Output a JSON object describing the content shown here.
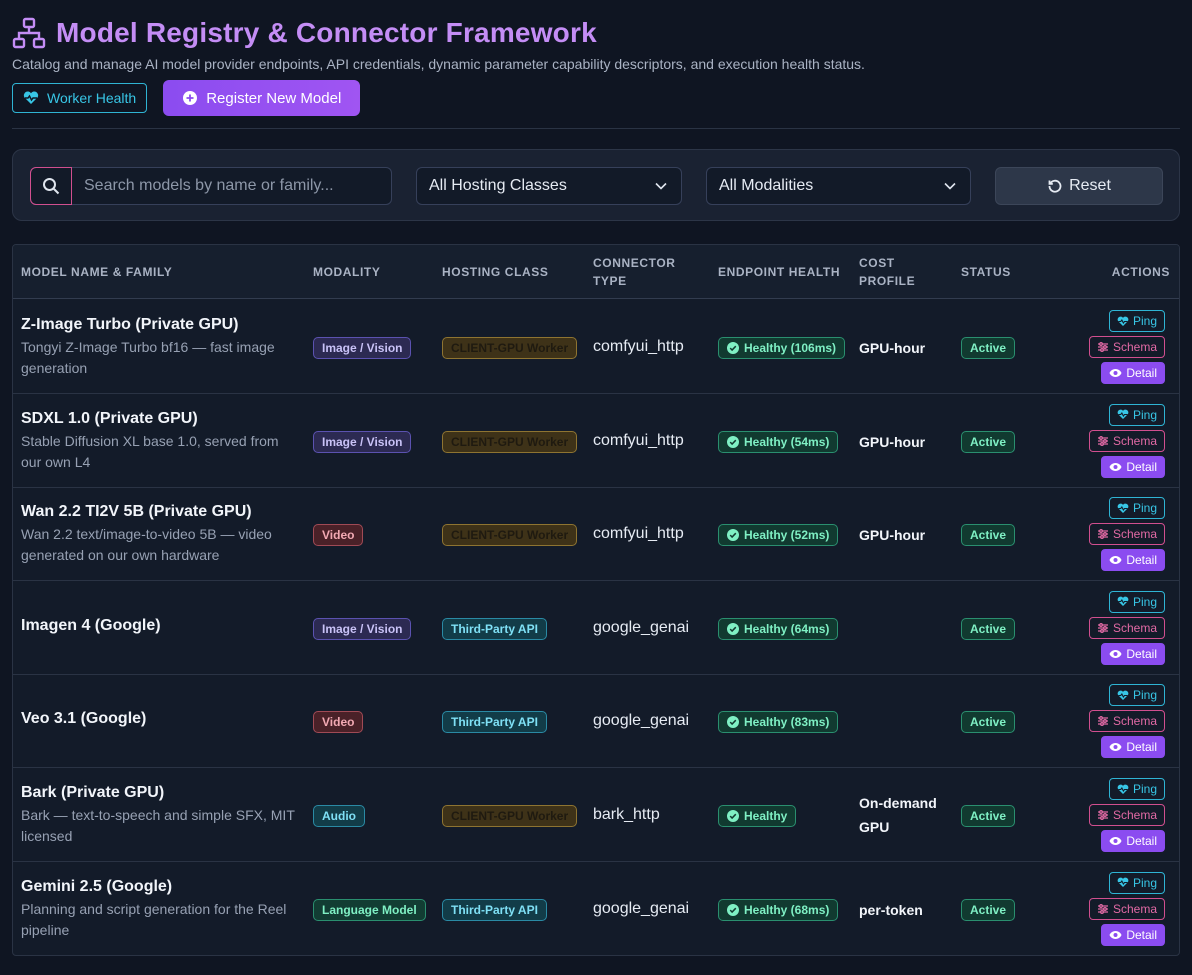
{
  "header": {
    "title": "Model Registry & Connector Framework",
    "subtitle": "Catalog and manage AI model provider endpoints, API credentials, dynamic parameter capability descriptors, and execution health status.",
    "worker_health_label": "Worker Health",
    "register_label": "Register New Model"
  },
  "filters": {
    "search_placeholder": "Search models by name or family...",
    "hosting_value": "All Hosting Classes",
    "modality_value": "All Modalities",
    "reset_label": "Reset"
  },
  "table": {
    "headers": {
      "model": "MODEL NAME & FAMILY",
      "modality": "MODALITY",
      "hosting": "HOSTING CLASS",
      "connector_l1": "CONNECTOR",
      "connector_l2": "TYPE",
      "health": "ENDPOINT HEALTH",
      "cost_l1": "COST",
      "cost_l2": "PROFILE",
      "status": "STATUS",
      "actions": "ACTIONS"
    },
    "action_labels": {
      "ping": "Ping",
      "schema": "Schema",
      "detail": "Detail"
    },
    "rows": [
      {
        "name": "Z-Image Turbo (Private GPU)",
        "desc": "Tongyi Z-Image Turbo bf16 — fast image generation",
        "modality": "Image / Vision",
        "hosting": "CLIENT-GPU Worker",
        "connector": "comfyui_http",
        "health": "Healthy (106ms)",
        "cost": "GPU-hour",
        "status": "Active"
      },
      {
        "name": "SDXL 1.0 (Private GPU)",
        "desc": "Stable Diffusion XL base 1.0, served from our own L4",
        "modality": "Image / Vision",
        "hosting": "CLIENT-GPU Worker",
        "connector": "comfyui_http",
        "health": "Healthy (54ms)",
        "cost": "GPU-hour",
        "status": "Active"
      },
      {
        "name": "Wan 2.2 TI2V 5B (Private GPU)",
        "desc": "Wan 2.2 text/image-to-video 5B — video generated on our own hardware",
        "modality": "Video",
        "hosting": "CLIENT-GPU Worker",
        "connector": "comfyui_http",
        "health": "Healthy (52ms)",
        "cost": "GPU-hour",
        "status": "Active"
      },
      {
        "name": "Imagen 4 (Google)",
        "desc": "",
        "modality": "Image / Vision",
        "hosting": "Third-Party API",
        "connector": "google_genai",
        "health": "Healthy (64ms)",
        "cost": "",
        "status": "Active"
      },
      {
        "name": "Veo 3.1 (Google)",
        "desc": "",
        "modality": "Video",
        "hosting": "Third-Party API",
        "connector": "google_genai",
        "health": "Healthy (83ms)",
        "cost": "",
        "status": "Active"
      },
      {
        "name": "Bark (Private GPU)",
        "desc": "Bark — text-to-speech and simple SFX, MIT licensed",
        "modality": "Audio",
        "hosting": "CLIENT-GPU Worker",
        "connector": "bark_http",
        "health": "Healthy",
        "cost": "On-demand GPU",
        "status": "Active"
      },
      {
        "name": "Gemini 2.5 (Google)",
        "desc": "Planning and script generation for the Reel pipeline",
        "modality": "Language Model",
        "hosting": "Third-Party API",
        "connector": "google_genai",
        "health": "Healthy (68ms)",
        "cost": "per-token",
        "status": "Active"
      }
    ]
  },
  "colors": {
    "accent_purple": "#8b4cf0",
    "title_purple": "#c48df5",
    "cyan": "#38c6e6",
    "pink": "#e26aa5",
    "green": "#7ff0c4"
  },
  "icons": {
    "title": "network-hierarchy-icon",
    "worker_health": "heart-pulse-icon",
    "register": "plus-circle-icon",
    "search": "search-icon",
    "select": "chevron-down-icon",
    "reset": "rotate-ccw-icon",
    "health": "check-circle-icon",
    "ping": "heart-pulse-icon",
    "schema": "sliders-icon",
    "detail": "eye-icon"
  }
}
